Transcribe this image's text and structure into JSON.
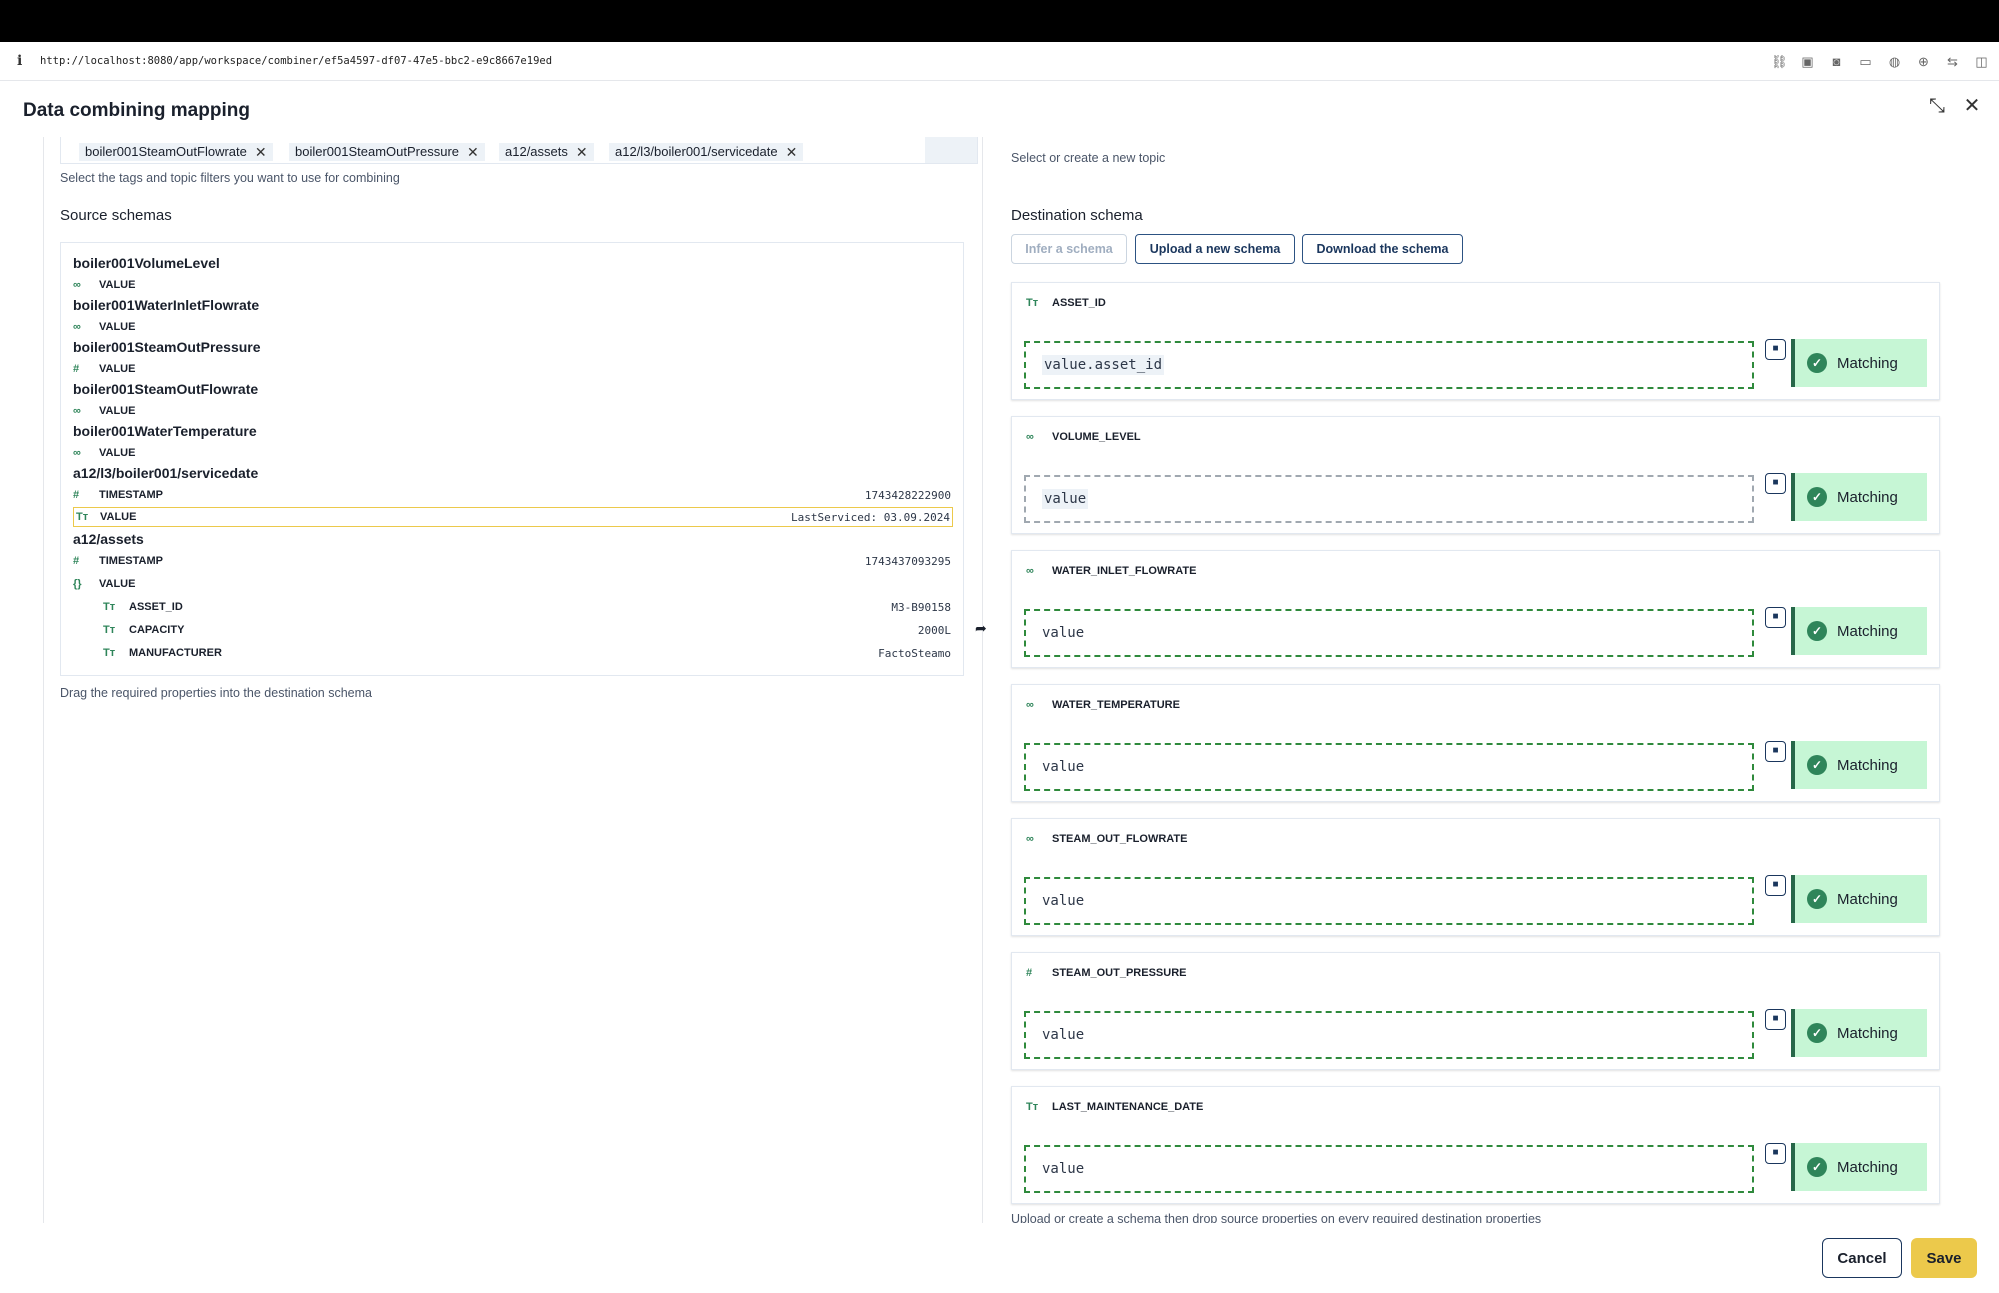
{
  "browser": {
    "info_icon": "info-icon",
    "url": "http://localhost:8080/app/workspace/combiner/ef5a4597-df07-47e5-bbc2-e9c8667e19ed"
  },
  "modal": {
    "title": "Data combining mapping"
  },
  "tags": [
    {
      "label": "boiler001SteamOutFlowrate"
    },
    {
      "label": "boiler001SteamOutPressure"
    },
    {
      "label": "a12/assets"
    },
    {
      "label": "a12/l3/boiler001/servicedate"
    }
  ],
  "help": {
    "tags": "Select the tags and topic filters you want to use for combining",
    "topic": "Select or create a new topic",
    "drag": "Drag the required properties into the destination schema",
    "upload": "Upload or create a schema then drop source properties on every required destination properties"
  },
  "source": {
    "heading": "Source schemas",
    "groups": [
      {
        "title": "boiler001VolumeLevel",
        "props": [
          {
            "type": "∞",
            "name": "VALUE",
            "value": ""
          }
        ]
      },
      {
        "title": "boiler001WaterInletFlowrate",
        "props": [
          {
            "type": "∞",
            "name": "VALUE",
            "value": ""
          }
        ]
      },
      {
        "title": "boiler001SteamOutPressure",
        "props": [
          {
            "type": "#",
            "name": "VALUE",
            "value": ""
          }
        ]
      },
      {
        "title": "boiler001SteamOutFlowrate",
        "props": [
          {
            "type": "∞",
            "name": "VALUE",
            "value": ""
          }
        ]
      },
      {
        "title": "boiler001WaterTemperature",
        "props": [
          {
            "type": "∞",
            "name": "VALUE",
            "value": ""
          }
        ]
      },
      {
        "title": "a12/l3/boiler001/servicedate",
        "props": [
          {
            "type": "#",
            "name": "TIMESTAMP",
            "value": "1743428222900"
          },
          {
            "type": "Tт",
            "name": "VALUE",
            "value": "LastServiced: 03.09.2024"
          }
        ]
      },
      {
        "title": "a12/assets",
        "props": [
          {
            "type": "#",
            "name": "TIMESTAMP",
            "value": "1743437093295"
          },
          {
            "type": "{}",
            "name": "VALUE",
            "value": ""
          },
          {
            "type": "Tт",
            "name": "ASSET_ID",
            "value": "M3-B90158"
          },
          {
            "type": "Tт",
            "name": "CAPACITY",
            "value": "2000L"
          },
          {
            "type": "Tт",
            "name": "MANUFACTURER",
            "value": "FactoSteamo"
          }
        ]
      }
    ]
  },
  "destination": {
    "heading": "Destination schema",
    "buttons": {
      "infer": "Infer a schema",
      "upload": "Upload a new schema",
      "download": "Download the schema"
    },
    "cards": [
      {
        "type": "Tт",
        "name": "ASSET_ID",
        "mapping": "value.asset_id",
        "status": "Matching"
      },
      {
        "type": "∞",
        "name": "VOLUME_LEVEL",
        "mapping": "value",
        "status": "Matching"
      },
      {
        "type": "∞",
        "name": "WATER_INLET_FLOWRATE",
        "mapping": "value",
        "status": "Matching"
      },
      {
        "type": "∞",
        "name": "WATER_TEMPERATURE",
        "mapping": "value",
        "status": "Matching"
      },
      {
        "type": "∞",
        "name": "STEAM_OUT_FLOWRATE",
        "mapping": "value",
        "status": "Matching"
      },
      {
        "type": "#",
        "name": "STEAM_OUT_PRESSURE",
        "mapping": "value",
        "status": "Matching"
      },
      {
        "type": "Tт",
        "name": "LAST_MAINTENANCE_DATE",
        "mapping": "value",
        "status": "Matching"
      }
    ]
  },
  "footer": {
    "cancel": "Cancel",
    "save": "Save"
  },
  "colors": {
    "accent": "#ECC94B",
    "matching_bg": "#C6F6D5",
    "dashed_border": "#2F8A3C"
  }
}
